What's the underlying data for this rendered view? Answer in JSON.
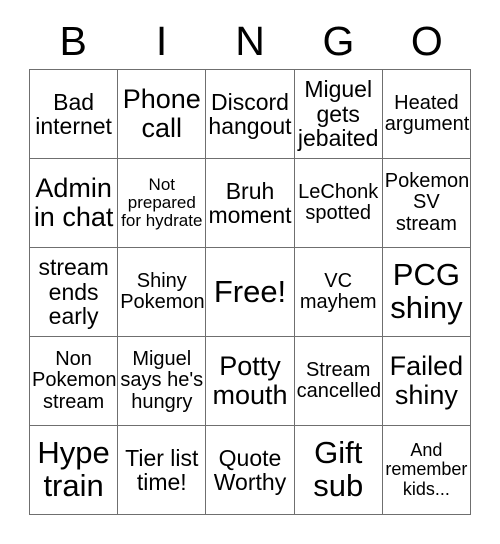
{
  "card": {
    "title": "BINGO",
    "header_letters": [
      "B",
      "I",
      "N",
      "G",
      "O"
    ],
    "free_space_label": "Free!",
    "colors": {
      "background": "#ffffff",
      "text": "#000000",
      "grid_line": "#6f6f6f"
    },
    "grid": {
      "rows": 5,
      "columns": 5,
      "cells": [
        {
          "text": "Bad internet",
          "size": "l"
        },
        {
          "text": "Phone call",
          "size": "xl"
        },
        {
          "text": "Discord hangout",
          "size": "l"
        },
        {
          "text": "Miguel gets jebaited",
          "size": "l"
        },
        {
          "text": "Heated argument",
          "size": "m"
        },
        {
          "text": "Admin in chat",
          "size": "xl"
        },
        {
          "text": "Not prepared for hydrate",
          "size": "s"
        },
        {
          "text": "Bruh moment",
          "size": "l"
        },
        {
          "text": "LeChonk spotted",
          "size": "m"
        },
        {
          "text": "Pokemon SV stream",
          "size": "m"
        },
        {
          "text": "stream ends early",
          "size": "l"
        },
        {
          "text": "Shiny Pokemon",
          "size": "m"
        },
        {
          "text": "Free!",
          "size": "xxl"
        },
        {
          "text": "VC mayhem",
          "size": "m"
        },
        {
          "text": "PCG shiny",
          "size": "xxl"
        },
        {
          "text": "Non Pokemon stream",
          "size": "m"
        },
        {
          "text": "Miguel says he's hungry",
          "size": "m"
        },
        {
          "text": "Potty mouth",
          "size": "xl"
        },
        {
          "text": "Stream cancelled",
          "size": "m"
        },
        {
          "text": "Failed shiny",
          "size": "xl"
        },
        {
          "text": "Hype train",
          "size": "xxl"
        },
        {
          "text": "Tier list time!",
          "size": "l"
        },
        {
          "text": "Quote Worthy",
          "size": "l"
        },
        {
          "text": "Gift sub",
          "size": "xxl"
        },
        {
          "text": "And remember kids...",
          "size": "m"
        }
      ]
    }
  }
}
